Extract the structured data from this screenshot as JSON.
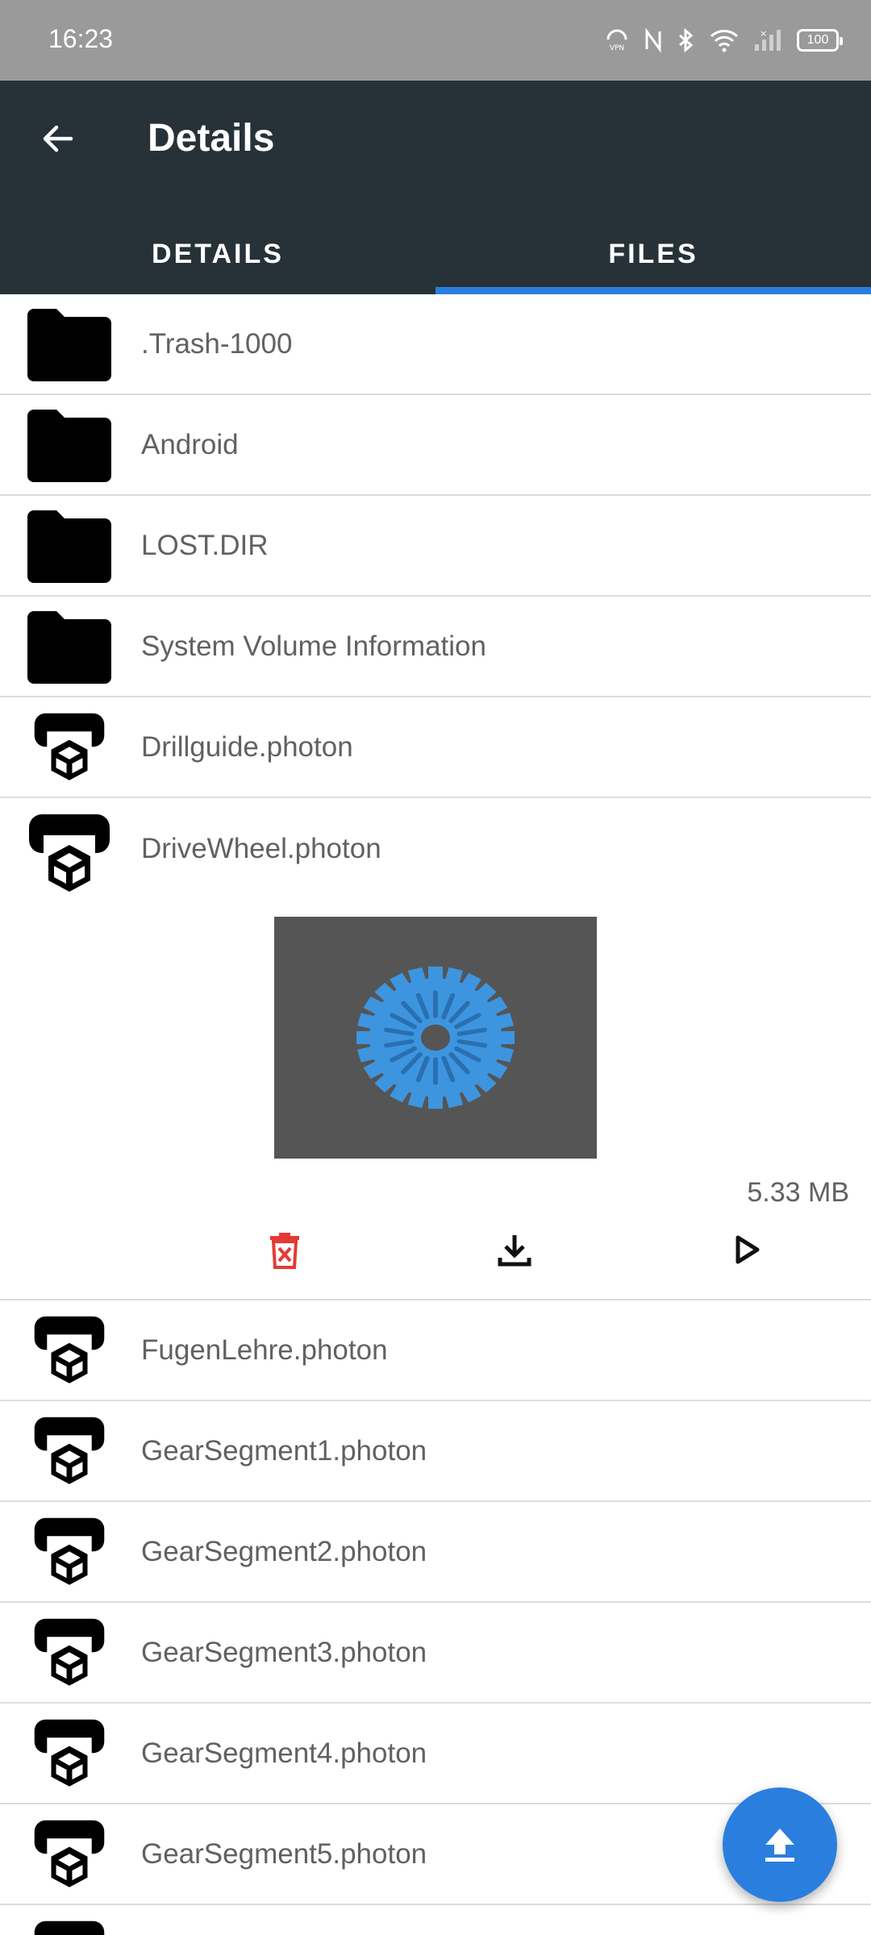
{
  "status_bar": {
    "time": "16:23",
    "battery": "100",
    "icons": [
      "vpn-icon",
      "nfc-icon",
      "bluetooth-icon",
      "wifi-icon",
      "signal-icon",
      "battery-icon"
    ]
  },
  "app_bar": {
    "title": "Details",
    "back_icon": "arrow-back-icon"
  },
  "tabs": [
    {
      "label": "DETAILS",
      "active": false
    },
    {
      "label": "FILES",
      "active": true
    }
  ],
  "files_before": [
    {
      "name": ".Trash-1000",
      "type": "folder"
    },
    {
      "name": "Android",
      "type": "folder"
    },
    {
      "name": "LOST.DIR",
      "type": "folder"
    },
    {
      "name": "System Volume Information",
      "type": "folder"
    },
    {
      "name": "Drillguide.photon",
      "type": "photon"
    }
  ],
  "expanded_file": {
    "name": "DriveWheel.photon",
    "type": "photon",
    "size": "5.33 MB",
    "actions": [
      "delete-icon",
      "download-icon",
      "play-icon"
    ]
  },
  "files_after": [
    {
      "name": "FugenLehre.photon",
      "type": "photon"
    },
    {
      "name": "GearSegment1.photon",
      "type": "photon"
    },
    {
      "name": "GearSegment2.photon",
      "type": "photon"
    },
    {
      "name": "GearSegment3.photon",
      "type": "photon"
    },
    {
      "name": "GearSegment4.photon",
      "type": "photon"
    },
    {
      "name": "GearSegment5.photon",
      "type": "photon"
    },
    {
      "name": "",
      "type": "photon"
    }
  ],
  "colors": {
    "accent": "#2a7fde",
    "app_bar": "#263238",
    "status_bar": "#9a9a9a",
    "delete": "#e53935"
  },
  "fab_icon": "upload-icon"
}
